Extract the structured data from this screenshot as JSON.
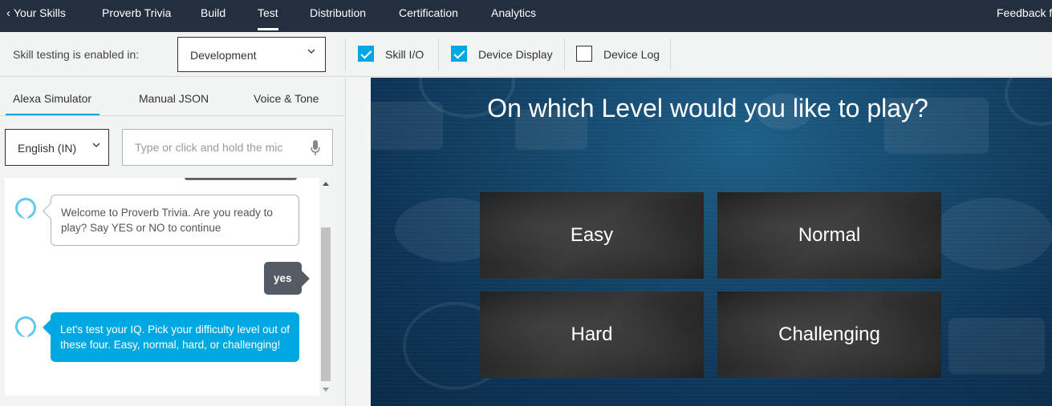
{
  "nav": {
    "back_label": "Your Skills",
    "items": [
      "Proverb Trivia",
      "Build",
      "Test",
      "Distribution",
      "Certification",
      "Analytics"
    ],
    "active": "Test",
    "feedback": "Feedback fo"
  },
  "toolbar": {
    "label": "Skill testing is enabled in:",
    "stage_value": "Development",
    "checkboxes": [
      {
        "label": "Skill I/O",
        "checked": true
      },
      {
        "label": "Device Display",
        "checked": true
      },
      {
        "label": "Device Log",
        "checked": false
      }
    ]
  },
  "left": {
    "tabs": [
      "Alexa Simulator",
      "Manual JSON",
      "Voice & Tone"
    ],
    "language": "English (IN)",
    "utterance_placeholder": "Type or click and hold the mic",
    "messages": [
      {
        "from": "alexa",
        "text": "Welcome to Proverb Trivia. Are you ready to play? Say YES or NO to continue"
      },
      {
        "from": "user",
        "text": "yes"
      },
      {
        "from": "alexa",
        "text": "Let's test your IQ. Pick your difficulty level out of these four. Easy, normal, hard, or challenging!"
      }
    ]
  },
  "display": {
    "question": "On which Level would you like to play?",
    "options": [
      "Easy",
      "Normal",
      "Hard",
      "Challenging"
    ]
  },
  "colors": {
    "nav_bg": "#232f3e",
    "accent": "#00a8e1",
    "user_bubble": "#545b64"
  }
}
